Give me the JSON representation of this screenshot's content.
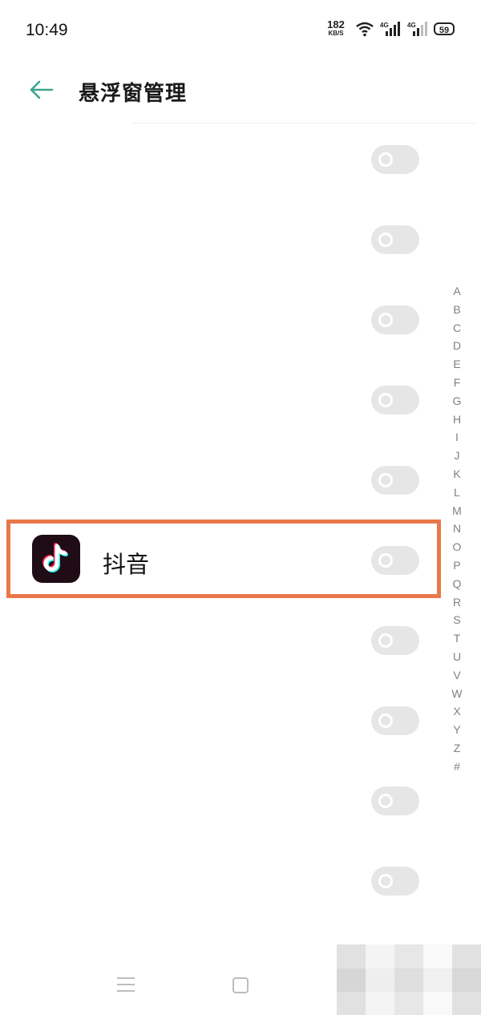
{
  "status_bar": {
    "time": "10:49",
    "net_speed_value": "182",
    "net_speed_unit": "KB/S",
    "signal_1_label": "4G",
    "signal_2_label": "4G",
    "battery": "59"
  },
  "header": {
    "title": "悬浮窗管理",
    "back_icon": "arrow-left-icon",
    "accent_color": "#3ca58e"
  },
  "apps": [
    {
      "label": "",
      "enabled": false
    },
    {
      "label": "",
      "enabled": false
    },
    {
      "label": "",
      "enabled": false
    },
    {
      "label": "",
      "enabled": false
    },
    {
      "label": "",
      "enabled": false
    },
    {
      "label": "抖音",
      "enabled": false,
      "icon": "tiktok-icon",
      "highlighted": true,
      "highlight_color": "#e8784a"
    },
    {
      "label": "",
      "enabled": false
    },
    {
      "label": "",
      "enabled": false
    },
    {
      "label": "",
      "enabled": false
    },
    {
      "label": "",
      "enabled": false
    }
  ],
  "alphabet_index": [
    "A",
    "B",
    "C",
    "D",
    "E",
    "F",
    "G",
    "H",
    "I",
    "J",
    "K",
    "L",
    "M",
    "N",
    "O",
    "P",
    "Q",
    "R",
    "S",
    "T",
    "U",
    "V",
    "W",
    "X",
    "Y",
    "Z",
    "#"
  ],
  "nav_bar": {
    "icons": [
      "menu-icon",
      "home-icon"
    ]
  }
}
